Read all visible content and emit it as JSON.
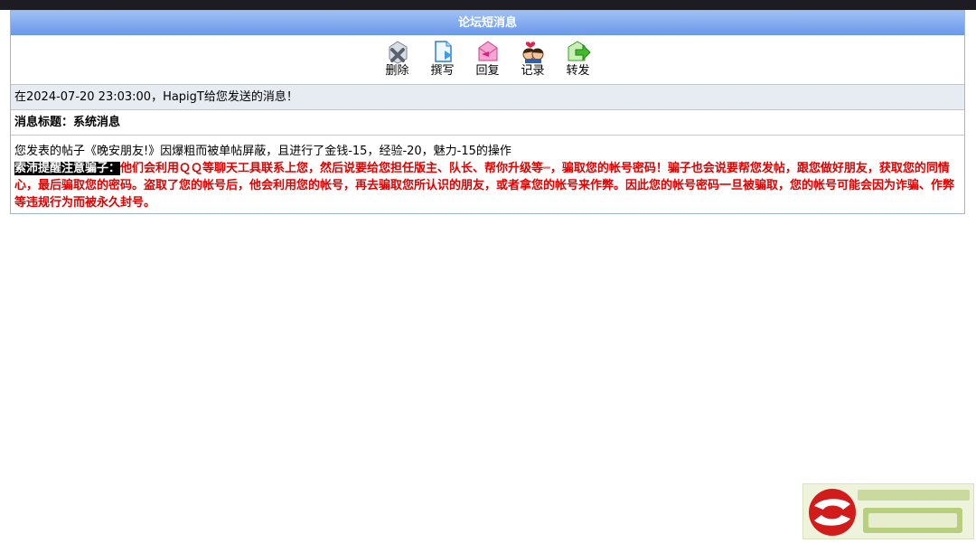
{
  "panel": {
    "title": "论坛短消息"
  },
  "toolbar": {
    "items": [
      {
        "label": "删除",
        "icon": "delete-icon"
      },
      {
        "label": "撰写",
        "icon": "compose-icon"
      },
      {
        "label": "回复",
        "icon": "reply-icon"
      },
      {
        "label": "记录",
        "icon": "record-icon"
      },
      {
        "label": "转发",
        "icon": "forward-icon"
      }
    ]
  },
  "message": {
    "sent_line": "在2024-07-20 23:03:00，HapigT给您发送的消息！",
    "subject_label": "消息标题：",
    "subject": "系统消息",
    "body": "您发表的帖子《晚安朋友!》因爆粗而被单帖屏蔽，且进行了金钱-15，经验-20，魅力-15的操作",
    "warning_label": "索沛提醒注意骗子：",
    "warning_text": "他们会利用ＱＱ等聊天工具联系上您，然后说要给您担任版主、队长、帮你升级等┉，骗取您的帐号密码！骗子也会说要帮您发帖，跟您做好朋友，获取您的同情心，最后骗取您的密码。盗取了您的帐号后，他会利用您的帐号，再去骗取您所认识的朋友，或者拿您的帐号来作弊。因此您的帐号密码一旦被骗取，您的帐号可能会因为诈骗、作弊等违规行为而被永久封号。"
  },
  "colors": {
    "title_bar": "#6a98e8",
    "warning": "#e00000",
    "border": "#9fb6d8"
  }
}
